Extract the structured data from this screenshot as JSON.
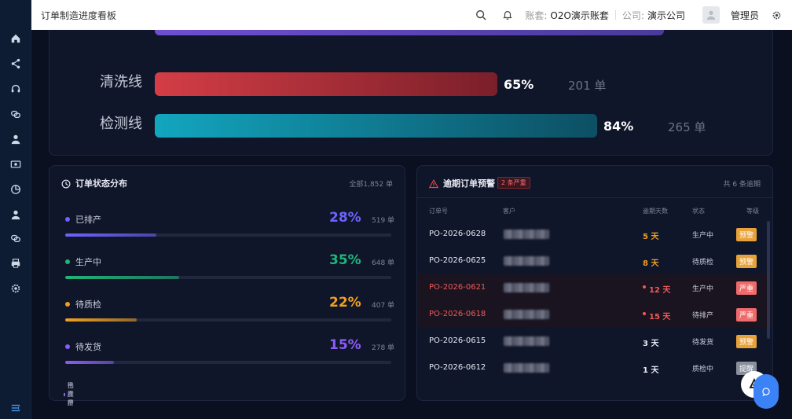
{
  "topbar": {
    "title": "订单制造进度看板",
    "account_label": "账套:",
    "account_value": "O2O演示账套",
    "company_label": "公司:",
    "company_value": "演示公司",
    "user": "管理员"
  },
  "production_lines": [
    {
      "name": "清洗线",
      "percent": 65,
      "percent_text": "65%",
      "count_text": "201 单",
      "color_from": "#d43d45",
      "color_to": "#7a1f2a"
    },
    {
      "name": "检测线",
      "percent": 84,
      "percent_text": "84%",
      "count_text": "265 单",
      "color_from": "#12a6bf",
      "color_to": "#0d4f63"
    }
  ],
  "status_card": {
    "title": "订单状态分布",
    "total_text": "全部1,852 单",
    "items": [
      {
        "label": "已排产",
        "percent": 28,
        "percent_text": "28%",
        "count_text": "519 单",
        "color": "#6c63ff"
      },
      {
        "label": "生产中",
        "percent": 35,
        "percent_text": "35%",
        "count_text": "648 单",
        "color": "#1fb57a"
      },
      {
        "label": "待质检",
        "percent": 22,
        "percent_text": "22%",
        "count_text": "407 单",
        "color": "#f0a020"
      },
      {
        "label": "待发货",
        "percent": 15,
        "percent_text": "15%",
        "count_text": "278 单",
        "color": "#8b5cf6"
      }
    ],
    "legend": [
      "已排产",
      "生产中",
      "待质检",
      "待发货"
    ]
  },
  "overdue_card": {
    "title": "逾期订单预警",
    "severe_badge": "2 条严重",
    "total_text": "共 6 条逾期",
    "headers": [
      "订单号",
      "客户",
      "逾期天数",
      "状态",
      "等级"
    ],
    "rows": [
      {
        "order": "PO-2026-0628",
        "days": "5 天",
        "status": "生产中",
        "level": "预警",
        "severity": "warn"
      },
      {
        "order": "PO-2026-0625",
        "days": "8 天",
        "status": "待质检",
        "level": "预警",
        "severity": "warn"
      },
      {
        "order": "PO-2026-0621",
        "days": "12 天",
        "status": "生产中",
        "level": "严重",
        "severity": "severe"
      },
      {
        "order": "PO-2026-0618",
        "days": "15 天",
        "status": "待排产",
        "level": "严重",
        "severity": "severe"
      },
      {
        "order": "PO-2026-0615",
        "days": "3 天",
        "status": "待发货",
        "level": "预警",
        "severity": "warn-white"
      },
      {
        "order": "PO-2026-0612",
        "days": "1 天",
        "status": "质检中",
        "level": "提醒",
        "severity": "remind"
      }
    ]
  },
  "colors": {
    "accent_purple": "#6c63ff",
    "severe_red": "#ef4444",
    "warn_amber": "#f0a020",
    "remind_gray": "#6b7280",
    "fab_blue": "#3b82f6"
  }
}
